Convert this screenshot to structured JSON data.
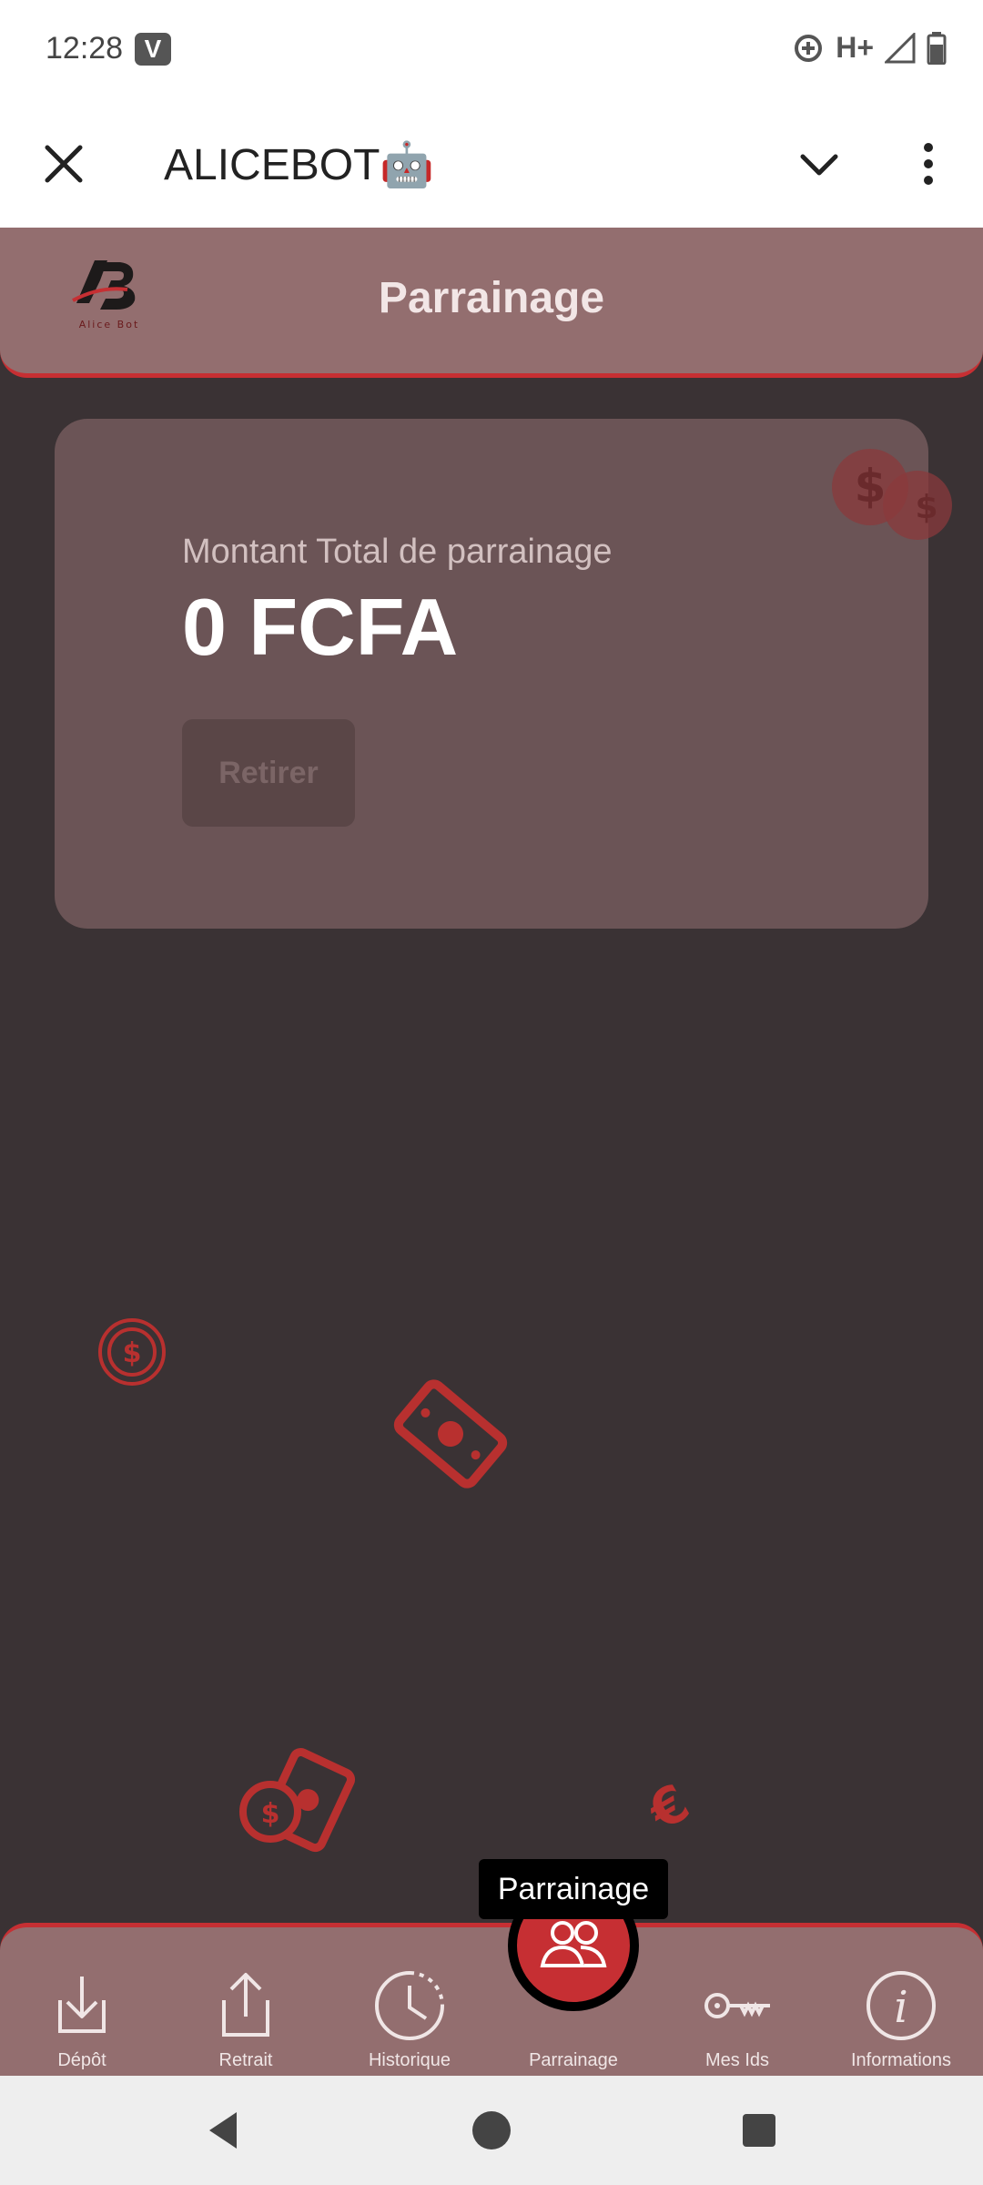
{
  "status_bar": {
    "time": "12:28",
    "app_icon_letter": "V",
    "network": "H+",
    "icons": [
      "data-saver-icon",
      "signal-icon",
      "battery-icon"
    ]
  },
  "toolbar": {
    "title": "ALICEBOT🤖",
    "icons": [
      "close-icon",
      "chevron-down-icon",
      "more-vert-icon"
    ]
  },
  "header": {
    "title": "Parrainage",
    "logo_icon": "alice-bot-logo",
    "logo_caption": "Alice Bot"
  },
  "card": {
    "label": "Montant Total de parrainage",
    "amount": "0 FCFA",
    "withdraw_label": "Retirer"
  },
  "tooltip": "Parrainage",
  "bottom_nav": {
    "items": [
      {
        "label": "Dépôt",
        "icon": "download-icon"
      },
      {
        "label": "Retrait",
        "icon": "upload-icon"
      },
      {
        "label": "Historique",
        "icon": "clock-icon"
      },
      {
        "label": "Parrainage",
        "icon": "people-icon",
        "active": true
      },
      {
        "label": "Mes Ids",
        "icon": "key-icon"
      },
      {
        "label": "Informations",
        "icon": "info-icon"
      }
    ]
  },
  "colors": {
    "accent": "#c62f33",
    "header_bg": "#936e6f",
    "page_bg": "#3a3234",
    "card_bg": "#6b5456"
  }
}
